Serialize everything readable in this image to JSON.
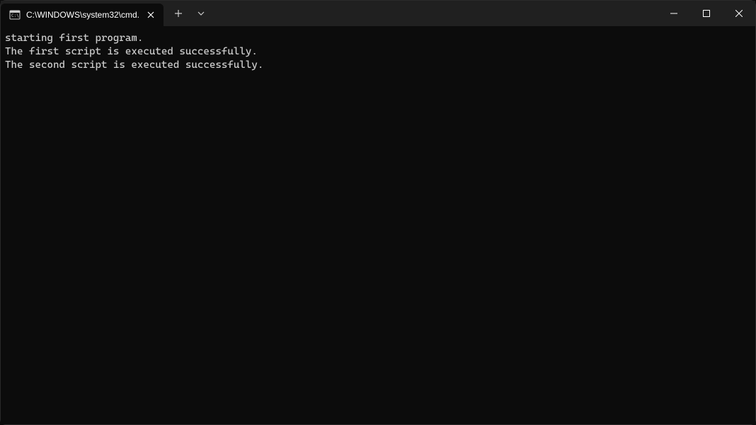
{
  "tab": {
    "title": "C:\\WINDOWS\\system32\\cmd."
  },
  "terminal": {
    "lines": [
      "starting first program.",
      "The first script is executed successfully.",
      "The second script is executed successfully."
    ]
  }
}
